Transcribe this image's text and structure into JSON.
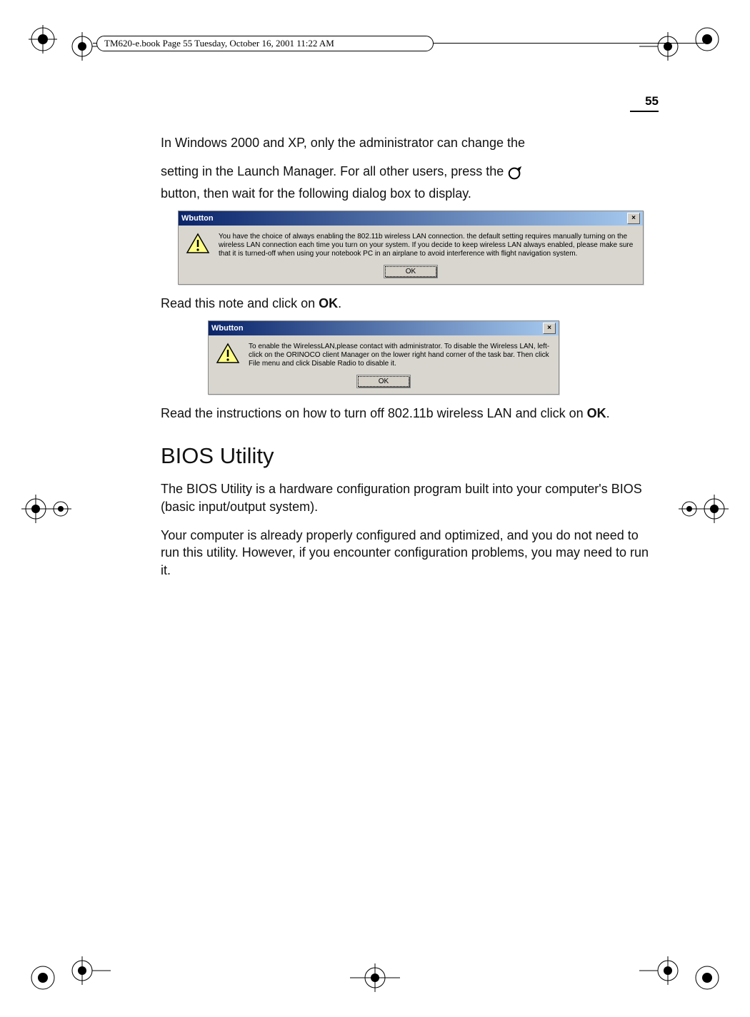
{
  "header": {
    "running_head": "TM620-e.book  Page 55  Tuesday, October 16, 2001  11:22 AM",
    "page_number": "55"
  },
  "body": {
    "p1a": "In Windows 2000 and XP, only the administrator can change the",
    "p1b_before": "setting in the Launch Manager. For all other users, press the ",
    "p1c": "button, then wait for the following dialog box to display.",
    "p2_before": "Read this note and click on ",
    "p2_bold": "OK",
    "p2_after": ".",
    "p3_before": "Read the instructions on how to turn off 802.11b wireless LAN and click on ",
    "p3_bold": "OK",
    "p3_after": ".",
    "h2": "BIOS Utility",
    "p4": "The BIOS Utility is a hardware configuration program built into your computer's BIOS (basic input/output system).",
    "p5": "Your computer is already properly configured and optimized, and you do not need to run this utility.  However, if you encounter configuration problems, you may need to run it."
  },
  "dialog1": {
    "title": "Wbutton",
    "message": "You have the choice of always enabling the 802.11b wireless LAN connection.  the default setting requires manually turning on the wireless LAN connection each time you turn on your system. If you decide to keep wireless LAN always enabled, please make sure that it is turned-off when using your notebook PC in an airplane to avoid interference with flight navigation system.",
    "ok": "OK",
    "close": "×"
  },
  "dialog2": {
    "title": "Wbutton",
    "message": "To enable the WirelessLAN,please contact with administrator. To disable the Wireless LAN, left-click on the ORINOCO client Manager on the lower right hand corner of the task bar. Then click File menu and click Disable Radio to disable it.",
    "ok": "OK",
    "close": "×"
  }
}
